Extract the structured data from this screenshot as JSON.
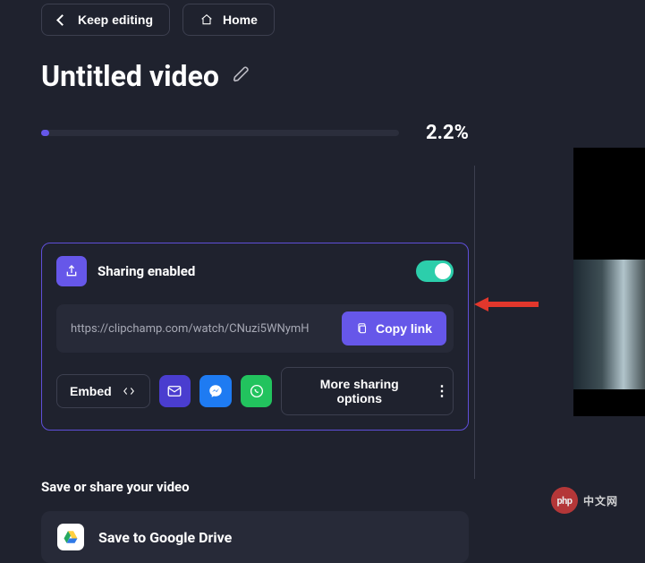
{
  "top_nav": {
    "keep_editing": "Keep editing",
    "home": "Home"
  },
  "title": "Untitled video",
  "progress": {
    "percent_text": "2.2%",
    "percent_value": 2.2
  },
  "sharing": {
    "heading": "Sharing enabled",
    "toggle_on": true,
    "link": "https://clipchamp.com/watch/CNuzi5WNymH",
    "copy_label": "Copy link",
    "embed_label": "Embed",
    "more_label": "More sharing options",
    "icons": {
      "share": "share-icon",
      "mail": "mail-icon",
      "messenger": "messenger-icon",
      "whatsapp": "whatsapp-icon",
      "code": "code-icon"
    }
  },
  "save_section": {
    "heading": "Save or share your video",
    "drive_label": "Save to Google Drive"
  },
  "watermark": {
    "logo_text": "php",
    "site_text": "中文网"
  },
  "colors": {
    "accent": "#6657e9",
    "bg": "#1f222e",
    "panel": "#272a38",
    "border": "#3c3f4f",
    "toggle_on": "#2cceab"
  }
}
